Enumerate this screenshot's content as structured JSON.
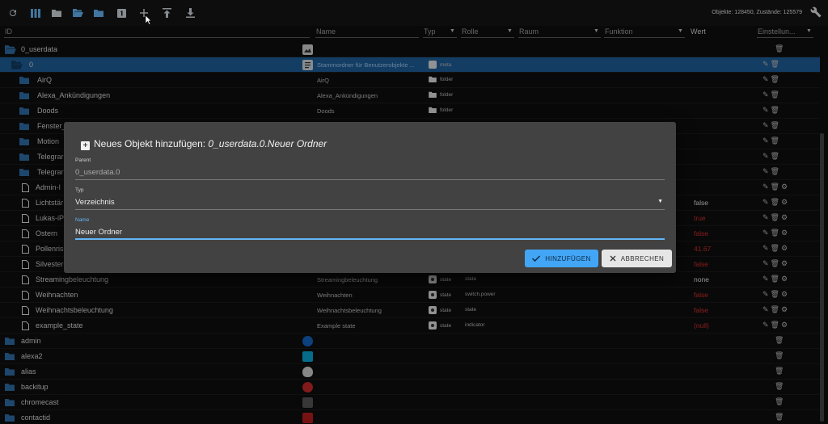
{
  "toolbar": {
    "icons": [
      "refresh-icon",
      "columns-icon",
      "folder-icon",
      "folder-open-icon",
      "folder-closed-icon",
      "number-one-icon",
      "plus-icon",
      "upload-icon",
      "download-icon"
    ],
    "status": "Objekte: 128450, Zustände: 125579"
  },
  "header": {
    "id": "ID",
    "name": "Name",
    "typ": "Typ",
    "rolle": "Rolle",
    "raum": "Raum",
    "funktion": "Funktion",
    "wert": "Wert",
    "einstellungen": "Einstellun..."
  },
  "rows": [
    {
      "name": "0_userdata"
    },
    {
      "name": "0",
      "nm2": "Stammordner für Benutzerobjekte ...",
      "typ": "meta"
    },
    {
      "name": "AirQ",
      "nm2": "AirQ",
      "typ": "folder"
    },
    {
      "name": "Alexa_Ankündigungen",
      "nm2": "Alexa_Ankündigungen",
      "typ": "folder"
    },
    {
      "name": "Doods",
      "nm2": "Doods",
      "typ": "folder"
    },
    {
      "name": "Fenster_"
    },
    {
      "name": "Motion"
    },
    {
      "name": "Telegrar"
    },
    {
      "name": "Telegrar"
    },
    {
      "name": "Admin-I"
    },
    {
      "name": "Lichtstär",
      "val": "false"
    },
    {
      "name": "Lukas-iP",
      "val": "true"
    },
    {
      "name": "Ostern",
      "val": "false"
    },
    {
      "name": "Pollenris",
      "val": "41.67"
    },
    {
      "name": "Silvester",
      "val": "false"
    },
    {
      "name": "Streamingbeleuchtung",
      "nm2": "Streamingbeleuchtung",
      "typ": "state",
      "rol": "state",
      "val": "none"
    },
    {
      "name": "Weihnachten",
      "nm2": "Weihnachten",
      "typ": "state",
      "rol": "switch.power",
      "val": "false"
    },
    {
      "name": "Weihnachtsbeleuchtung",
      "nm2": "Weihnachtsbeleuchtung",
      "typ": "state",
      "rol": "state",
      "val": "false"
    },
    {
      "name": "example_state",
      "nm2": "Example state",
      "typ": "state",
      "rol": "indicator",
      "val": "(null)"
    },
    {
      "name": "admin"
    },
    {
      "name": "alexa2"
    },
    {
      "name": "alias"
    },
    {
      "name": "backitup"
    },
    {
      "name": "chromecast"
    },
    {
      "name": "contactid"
    }
  ],
  "dialog": {
    "title_prefix": "Neues Objekt hinzufügen: ",
    "title_path": "0_userdata.0.Neuer Ordner",
    "parent_label": "Parent",
    "parent_value": "0_userdata.0",
    "typ_label": "Typ",
    "typ_value": "Verzeichnis",
    "name_label": "Name",
    "name_value": "Neuer Ordner",
    "add_label": "HINZUFÜGEN",
    "cancel_label": "ABBRECHEN"
  },
  "colors": {
    "accent": "#42a5f5",
    "selected_row": "#1f5f9a",
    "value_red": "#d32f2f",
    "folder_blue": "#2f6ea8"
  }
}
